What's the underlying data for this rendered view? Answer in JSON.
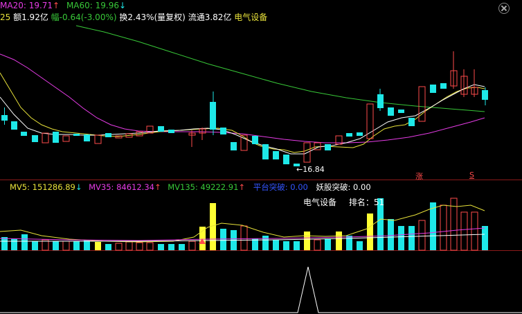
{
  "header": {
    "ma20_label": "MA20: 19.71",
    "ma20_arrow": "↑",
    "ma60_label": "MA60: 19.96",
    "ma60_arrow": "↓",
    "row2_prefix": "25",
    "amount": "额1.92亿",
    "change": "幅-0.64(-3.00%)",
    "turnover": "换2.43%(量复权)",
    "float_cap": "流通3.82亿",
    "sector": "电气设备"
  },
  "chart_annotations": {
    "low_marker": "←16.84",
    "zhang_label": "涨",
    "s_label": "S"
  },
  "volume_header": {
    "mv5": "MV5: 151286.89",
    "mv5_arrow": "↓",
    "mv35": "MV35: 84612.34",
    "mv35_arrow": "↑",
    "mv135": "MV135: 49222.91",
    "mv135_arrow": "↑",
    "platform": "平台突破: 0.00",
    "demon": "妖股突破: 0.00"
  },
  "volume_overlay": {
    "sector": "电气设备",
    "rank_label": "排名：",
    "rank_value": "51"
  },
  "colors": {
    "ma_yellow": "#e8e23a",
    "ma_magenta": "#e63ce6",
    "ma_green": "#38c838",
    "up": "#ff4b4b",
    "down": "#1ee8e8",
    "highlight": "#ffff33"
  },
  "icons": {
    "close": "close-icon"
  }
}
